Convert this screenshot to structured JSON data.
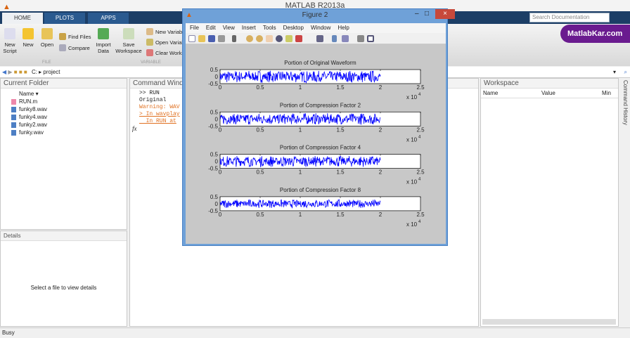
{
  "app": {
    "title": "MATLAB R2013a",
    "status": "Busy"
  },
  "tabs": [
    "HOME",
    "PLOTS",
    "APPS"
  ],
  "ribbon": {
    "new_script": "New Script",
    "new": "New",
    "open": "Open",
    "find_files": "Find Files",
    "compare": "Compare",
    "import_data": "Import Data",
    "save_workspace": "Save Workspace",
    "new_variable": "New Variable",
    "open_variable": "Open Variable",
    "clear_workspace": "Clear Workspace",
    "group_file": "FILE",
    "group_variable": "VARIABLE"
  },
  "search": {
    "placeholder": "Search Documentation"
  },
  "brand": "MatlabKar.com",
  "address": {
    "drive": "C:",
    "folder": "project"
  },
  "current_folder": {
    "title": "Current Folder",
    "col_name": "Name",
    "files": [
      "RUN.m",
      "funky8.wav",
      "funky4.wav",
      "funky2.wav",
      "funky.wav"
    ]
  },
  "details": {
    "title": "Details",
    "message": "Select a file to view details"
  },
  "command_window": {
    "title": "Command Window",
    "lines": [
      ">> RUN",
      "Original"
    ],
    "warning": "Warning: WAV",
    "trace1": "> In wavplay",
    "trace2": "  In RUN at",
    "fx": "fx"
  },
  "workspace": {
    "title": "Workspace",
    "cols": [
      "Name",
      "Value",
      "Min"
    ]
  },
  "command_history": {
    "title": "Command History"
  },
  "figure": {
    "title": "Figure 2",
    "menu": [
      "File",
      "Edit",
      "View",
      "Insert",
      "Tools",
      "Desktop",
      "Window",
      "Help"
    ]
  },
  "chart_data": [
    {
      "type": "line",
      "title": "Portion of Original Waveform",
      "xlim": [
        0,
        25000
      ],
      "ylim": [
        -0.5,
        0.5
      ],
      "xticks": [
        "0",
        "0.5",
        "1",
        "1.5",
        "2",
        "2.5"
      ],
      "yticks": [
        "0.5",
        "0",
        "-0.5"
      ],
      "x_multiplier": "x 10",
      "x_exponent": "4",
      "data_range": [
        0,
        20000
      ],
      "amplitude": 0.45,
      "color": "#0000ff"
    },
    {
      "type": "line",
      "title": "Portion of Compression Factor 2",
      "xlim": [
        0,
        25000
      ],
      "ylim": [
        -0.5,
        0.5
      ],
      "xticks": [
        "0",
        "0.5",
        "1",
        "1.5",
        "2",
        "2.5"
      ],
      "yticks": [
        "0.5",
        "0",
        "-0.5"
      ],
      "x_multiplier": "x 10",
      "x_exponent": "4",
      "data_range": [
        0,
        20000
      ],
      "amplitude": 0.42,
      "color": "#0000ff"
    },
    {
      "type": "line",
      "title": "Portion of Compression Factor 4",
      "xlim": [
        0,
        25000
      ],
      "ylim": [
        -0.5,
        0.5
      ],
      "xticks": [
        "0",
        "0.5",
        "1",
        "1.5",
        "2",
        "2.5"
      ],
      "yticks": [
        "0.5",
        "0",
        "-0.5"
      ],
      "x_multiplier": "x 10",
      "x_exponent": "4",
      "data_range": [
        0,
        20000
      ],
      "amplitude": 0.4,
      "color": "#0000ff"
    },
    {
      "type": "line",
      "title": "Portion of Compression Factor 8",
      "xlim": [
        0,
        25000
      ],
      "ylim": [
        -0.5,
        0.5
      ],
      "xticks": [
        "0",
        "0.5",
        "1",
        "1.5",
        "2",
        "2.5"
      ],
      "yticks": [
        "0.5",
        "0",
        "-0.5"
      ],
      "x_multiplier": "x 10",
      "x_exponent": "4",
      "data_range": [
        0,
        20000
      ],
      "amplitude": 0.3,
      "color": "#0000ff"
    }
  ]
}
